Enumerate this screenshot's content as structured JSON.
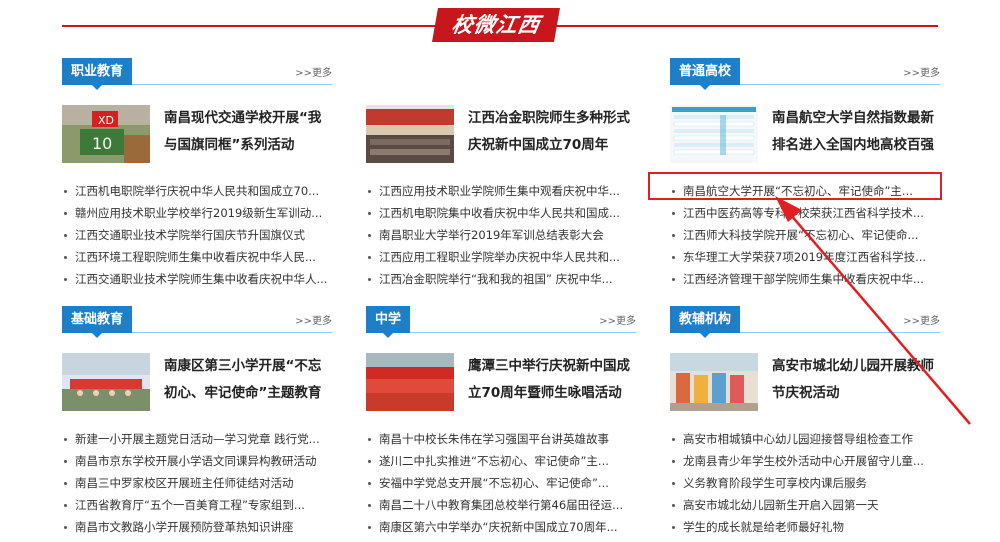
{
  "banner": {
    "title": "校微江西"
  },
  "more_label": ">>更多",
  "sections": {
    "zhiye": {
      "tag": "职业教育",
      "feature_title": "南昌现代交通学校开展“我与国旗同框”系列活动",
      "items": [
        "江西机电职院举行庆祝中华人民共和国成立70...",
        "赣州应用技术职业学校举行2019级新生军训动...",
        "江西交通职业技术学院举行国庆节升国旗仪式",
        "江西环境工程职院师生集中收看庆祝中华人民...",
        "江西交通职业技术学院师生集中收看庆祝中华人..."
      ]
    },
    "zhiye2": {
      "feature_title": "江西冶金职院师生多种形式庆祝新中国成立70周年",
      "items": [
        "江西应用技术职业学院师生集中观看庆祝中华...",
        "江西机电职院集中收看庆祝中华人民共和国成...",
        "南昌职业大学举行2019年军训总结表彰大会",
        "江西应用工程职业学院举办庆祝中华人民共和...",
        "江西冶金职院举行“我和我的祖国” 庆祝中华..."
      ]
    },
    "putong": {
      "tag": "普通高校",
      "feature_title": "南昌航空大学自然指数最新排名进入全国内地高校百强",
      "items": [
        "南昌航空大学开展“不忘初心、牢记使命”主...",
        "江西中医药高等专科学校荣获江西省科学技术...",
        "江西师大科技学院开展“不忘初心、牢记使命...",
        "东华理工大学荣获7项2019年度江西省科学技...",
        "江西经济管理干部学院师生集中收看庆祝中华..."
      ]
    },
    "jichu": {
      "tag": "基础教育",
      "feature_title": "南康区第三小学开展“不忘初心、牢记使命”主题教育",
      "items": [
        "新建一小开展主题党日活动—学习党章 践行党...",
        "南昌市京东学校开展小学语文同课异构教研活动",
        "南昌三中罗家校区开展班主任师徒结对活动",
        "江西省教育厅“五个一百美育工程”专家组到...",
        "南昌市文教路小学开展预防登革热知识讲座"
      ]
    },
    "zhongxue": {
      "tag": "中学",
      "feature_title": "鹰潭三中举行庆祝新中国成立70周年暨师生咏唱活动",
      "items": [
        "南昌十中校长朱伟在学习强国平台讲英雄故事",
        "遂川二中扎实推进“不忘初心、牢记使命”主...",
        "安福中学党总支开展“不忘初心、牢记使命”...",
        "南昌二十八中教育集团总校举行第46届田径运...",
        "南康区第六中学举办“庆祝新中国成立70周年..."
      ]
    },
    "jiaofu": {
      "tag": "教辅机构",
      "feature_title": "高安市城北幼儿园开展教师节庆祝活动",
      "items": [
        "高安市相城镇中心幼儿园迎接督导组检查工作",
        "龙南县青少年学生校外活动中心开展留守儿童...",
        "义务教育阶段学生可享校内课后服务",
        "高安市城北幼儿园新生开启入园第一天",
        "学生的成长就是给老师最好礼物"
      ]
    }
  },
  "colors": {
    "brand_red": "#c8161d",
    "tag_blue": "#1e7fc8",
    "highlight": "#e02020"
  }
}
